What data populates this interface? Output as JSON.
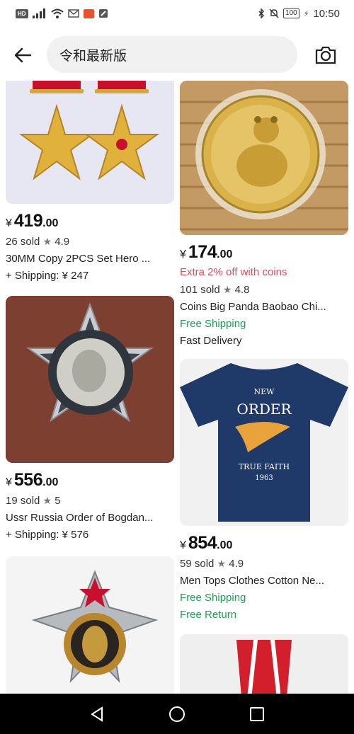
{
  "status_bar": {
    "hd": "HD",
    "time": "10:50",
    "battery": "100"
  },
  "search": {
    "query": "令和最新版"
  },
  "products": [
    {
      "currency": "¥",
      "price_int": "419",
      "price_dec": ".00",
      "sold": "26 sold",
      "rating": "4.9",
      "title": "30MM Copy 2PCS Set Hero ...",
      "extra": [
        "+ Shipping: ¥ 247"
      ]
    },
    {
      "currency": "¥",
      "price_int": "174",
      "price_dec": ".00",
      "promo": "Extra 2% off with coins",
      "sold": "101 sold",
      "rating": "4.8",
      "title": "Coins Big Panda Baobao Chi...",
      "extra": [
        "Free Shipping",
        "Fast Delivery"
      ]
    },
    {
      "currency": "¥",
      "price_int": "556",
      "price_dec": ".00",
      "sold": "19 sold",
      "rating": "5",
      "title": "Ussr Russia Order of Bogdan...",
      "extra": [
        "+ Shipping: ¥ 576"
      ]
    },
    {
      "currency": "¥",
      "price_int": "854",
      "price_dec": ".00",
      "sold": "59 sold",
      "rating": "4.9",
      "title": "Men Tops Clothes Cotton Ne...",
      "extra": [
        "Free Shipping",
        "Free Return"
      ],
      "shirt_text": {
        "top": "NEW",
        "main": "ORDER",
        "sub": "TRUE  FAITH",
        "year": "1963"
      }
    }
  ],
  "colors": {
    "green": "#1f9d55",
    "promo_red": "#e04a5a",
    "search_bg": "#f1f1f1"
  },
  "icons": {
    "back": "arrow-left-icon",
    "camera": "camera-icon",
    "star": "star-icon"
  }
}
